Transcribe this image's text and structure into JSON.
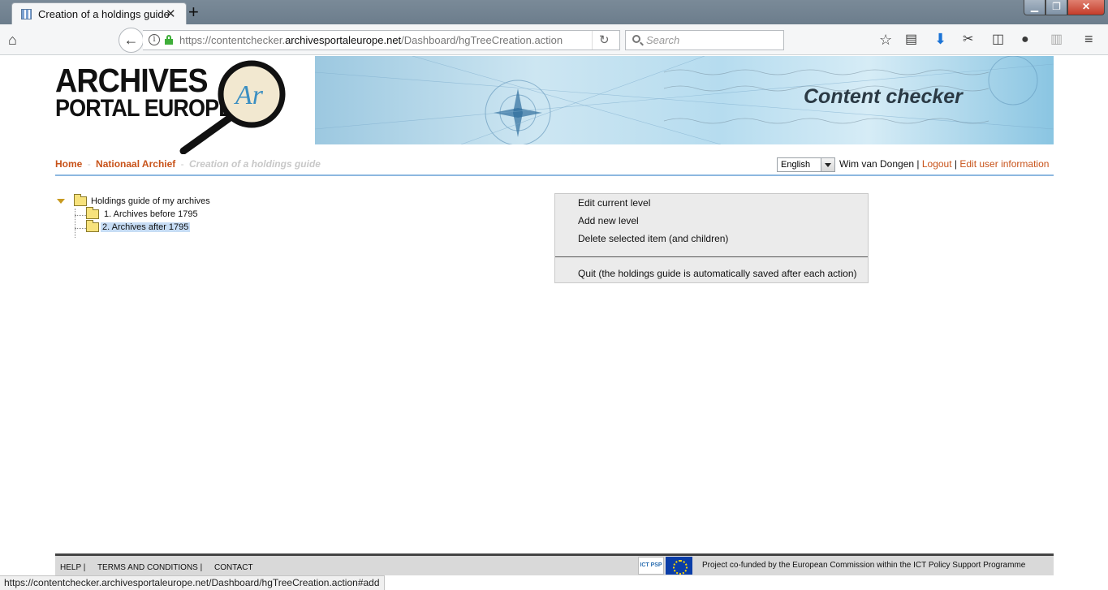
{
  "browser": {
    "tab_title": "Creation of a holdings guide",
    "new_tab_symbol": "+",
    "url_prefix": "https://contentchecker.",
    "url_domain": "archivesportaleurope.net",
    "url_path": "/Dashboard/hgTreeCreation.action",
    "search_placeholder": "Search",
    "status_url": "https://contentchecker.archivesportaleurope.net/Dashboard/hgTreeCreation.action#add"
  },
  "header": {
    "logo_line1": "ARCHIVES",
    "logo_line2": "PORTAL EUROPE",
    "banner_title": "Content checker"
  },
  "breadcrumb": {
    "home": "Home",
    "sep": "-",
    "institution": "Nationaal Archief",
    "current": "Creation of a holdings guide"
  },
  "user": {
    "language": "English",
    "name": "Wim van Dongen",
    "sep": "|",
    "logout": "Logout",
    "edit": "Edit user information"
  },
  "tree": {
    "root": "Holdings guide of my archives",
    "children": [
      "1. Archives before 1795",
      "2. Archives after 1795"
    ]
  },
  "menu": {
    "edit": "Edit current level",
    "add": "Add new level",
    "delete": "Delete selected item (and children)",
    "quit": "Quit (the holdings guide is automatically saved after each action)"
  },
  "footer": {
    "help": "HELP |",
    "terms": "TERMS AND CONDITIONS |",
    "contact": "CONTACT",
    "ict_logo": "ICT PSP",
    "project": "Project co-funded by the European Commission within the ICT Policy Support Programme"
  }
}
